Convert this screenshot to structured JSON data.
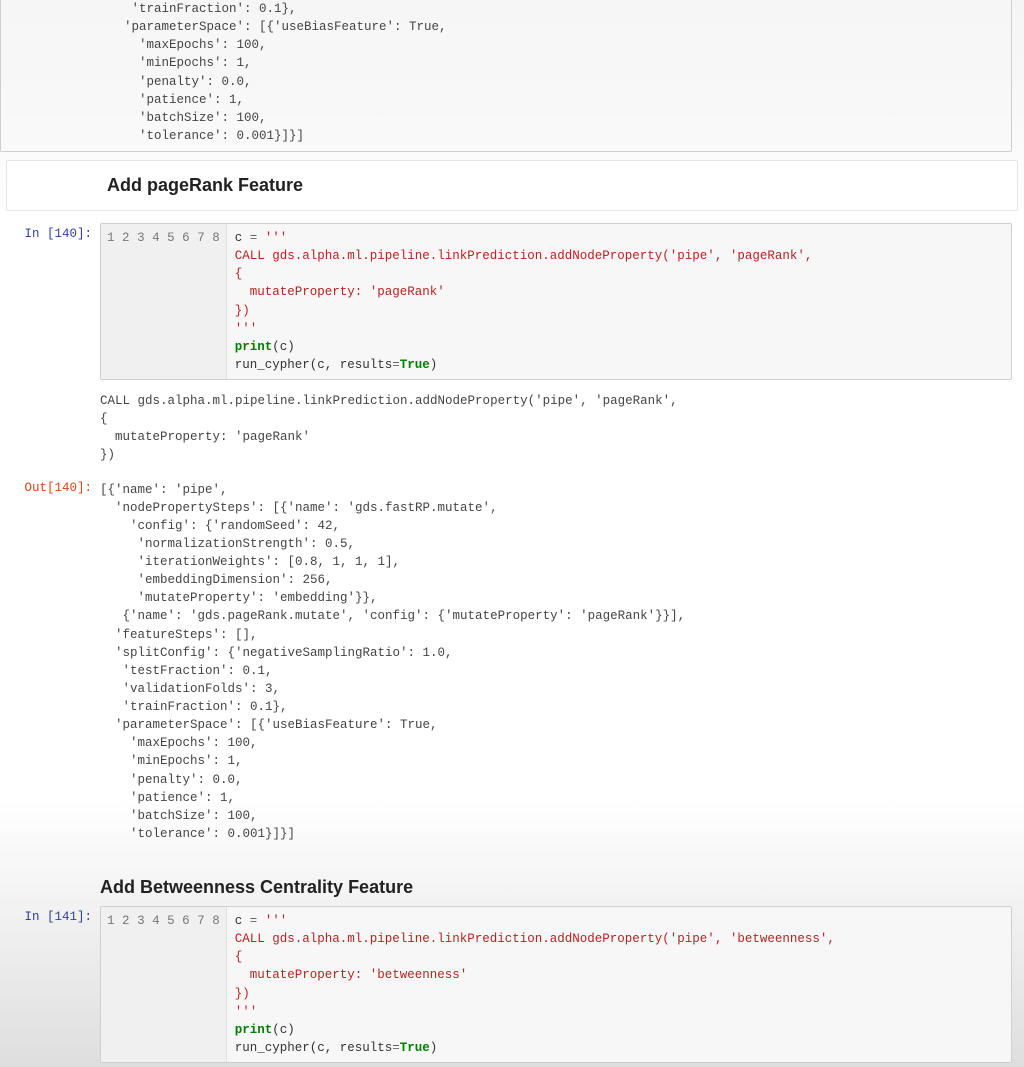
{
  "top_fragment": {
    "lines": [
      "   'trainFraction': 0.1},",
      "  'parameterSpace': [{'useBiasFeature': True,",
      "    'maxEpochs': 100,",
      "    'minEpochs': 1,",
      "    'penalty': 0.0,",
      "    'patience': 1,",
      "    'batchSize': 100,",
      "    'tolerance': 0.001}]}]"
    ]
  },
  "heading1": "Add pageRank Feature",
  "cell140": {
    "prompt_in": "In [140]:",
    "prompt_out": "Out[140]:",
    "gutter": [
      "1",
      "2",
      "3",
      "4",
      "5",
      "6",
      "7",
      "8"
    ],
    "code": {
      "l1_a": "c ",
      "l1_b": "= ",
      "l1_c": "'''",
      "l2": "CALL gds.alpha.ml.pipeline.linkPrediction.addNodeProperty('pipe', 'pageRank',",
      "l3": "{",
      "l4": "  mutateProperty: 'pageRank'",
      "l5": "})",
      "l6": "'''",
      "l7_a": "print",
      "l7_b": "(c)",
      "l8_a": "run_cypher(c, results",
      "l8_b": "=",
      "l8_c": "True",
      "l8_d": ")"
    },
    "stdout": "CALL gds.alpha.ml.pipeline.linkPrediction.addNodeProperty('pipe', 'pageRank',\n{\n  mutateProperty: 'pageRank'\n})",
    "result": "[{'name': 'pipe',\n  'nodePropertySteps': [{'name': 'gds.fastRP.mutate',\n    'config': {'randomSeed': 42,\n     'normalizationStrength': 0.5,\n     'iterationWeights': [0.8, 1, 1, 1],\n     'embeddingDimension': 256,\n     'mutateProperty': 'embedding'}},\n   {'name': 'gds.pageRank.mutate', 'config': {'mutateProperty': 'pageRank'}}],\n  'featureSteps': [],\n  'splitConfig': {'negativeSamplingRatio': 1.0,\n   'testFraction': 0.1,\n   'validationFolds': 3,\n   'trainFraction': 0.1},\n  'parameterSpace': [{'useBiasFeature': True,\n    'maxEpochs': 100,\n    'minEpochs': 1,\n    'penalty': 0.0,\n    'patience': 1,\n    'batchSize': 100,\n    'tolerance': 0.001}]}]"
  },
  "heading2": "Add Betweenness Centrality Feature",
  "cell141": {
    "prompt_in": "In [141]:",
    "gutter": [
      "1",
      "2",
      "3",
      "4",
      "5",
      "6",
      "7",
      "8"
    ],
    "code": {
      "l1_a": "c ",
      "l1_b": "= ",
      "l1_c": "'''",
      "l2": "CALL gds.alpha.ml.pipeline.linkPrediction.addNodeProperty('pipe', 'betweenness',",
      "l3": "{",
      "l4": "  mutateProperty: 'betweenness'",
      "l5": "})",
      "l6": "'''",
      "l7_a": "print",
      "l7_b": "(c)",
      "l8_a": "run_cypher(c, results",
      "l8_b": "=",
      "l8_c": "True",
      "l8_d": ")"
    }
  }
}
